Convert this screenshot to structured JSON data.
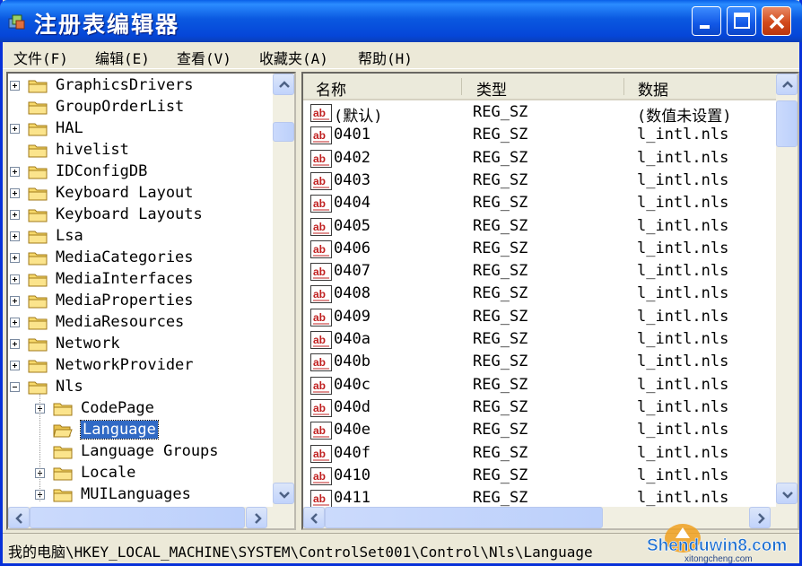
{
  "window": {
    "title": "注册表编辑器"
  },
  "menu": [
    {
      "label": "文件(F)"
    },
    {
      "label": "编辑(E)"
    },
    {
      "label": "查看(V)"
    },
    {
      "label": "收藏夹(A)"
    },
    {
      "label": "帮助(H)"
    }
  ],
  "tree": {
    "items": [
      {
        "label": "GraphicsDrivers",
        "expander": "plus",
        "level": 0
      },
      {
        "label": "GroupOrderList",
        "expander": "none",
        "level": 0
      },
      {
        "label": "HAL",
        "expander": "plus",
        "level": 0
      },
      {
        "label": "hivelist",
        "expander": "none",
        "level": 0
      },
      {
        "label": "IDConfigDB",
        "expander": "plus",
        "level": 0
      },
      {
        "label": "Keyboard Layout",
        "expander": "plus",
        "level": 0
      },
      {
        "label": "Keyboard Layouts",
        "expander": "plus",
        "level": 0
      },
      {
        "label": "Lsa",
        "expander": "plus",
        "level": 0
      },
      {
        "label": "MediaCategories",
        "expander": "plus",
        "level": 0
      },
      {
        "label": "MediaInterfaces",
        "expander": "plus",
        "level": 0
      },
      {
        "label": "MediaProperties",
        "expander": "plus",
        "level": 0
      },
      {
        "label": "MediaResources",
        "expander": "plus",
        "level": 0
      },
      {
        "label": "Network",
        "expander": "plus",
        "level": 0
      },
      {
        "label": "NetworkProvider",
        "expander": "plus",
        "level": 0
      },
      {
        "label": "Nls",
        "expander": "minus",
        "level": 0
      },
      {
        "label": "CodePage",
        "expander": "plus",
        "level": 1
      },
      {
        "label": "Language",
        "expander": "none",
        "level": 1,
        "selected": true
      },
      {
        "label": "Language Groups",
        "expander": "none",
        "level": 1
      },
      {
        "label": "Locale",
        "expander": "plus",
        "level": 1
      },
      {
        "label": "MUILanguages",
        "expander": "plus",
        "level": 1
      }
    ]
  },
  "list": {
    "columns": [
      "名称",
      "类型",
      "数据"
    ],
    "rows": [
      {
        "name": "(默认)",
        "type": "REG_SZ",
        "data": "(数值未设置)"
      },
      {
        "name": "0401",
        "type": "REG_SZ",
        "data": "l_intl.nls"
      },
      {
        "name": "0402",
        "type": "REG_SZ",
        "data": "l_intl.nls"
      },
      {
        "name": "0403",
        "type": "REG_SZ",
        "data": "l_intl.nls"
      },
      {
        "name": "0404",
        "type": "REG_SZ",
        "data": "l_intl.nls"
      },
      {
        "name": "0405",
        "type": "REG_SZ",
        "data": "l_intl.nls"
      },
      {
        "name": "0406",
        "type": "REG_SZ",
        "data": "l_intl.nls"
      },
      {
        "name": "0407",
        "type": "REG_SZ",
        "data": "l_intl.nls"
      },
      {
        "name": "0408",
        "type": "REG_SZ",
        "data": "l_intl.nls"
      },
      {
        "name": "0409",
        "type": "REG_SZ",
        "data": "l_intl.nls"
      },
      {
        "name": "040a",
        "type": "REG_SZ",
        "data": "l_intl.nls"
      },
      {
        "name": "040b",
        "type": "REG_SZ",
        "data": "l_intl.nls"
      },
      {
        "name": "040c",
        "type": "REG_SZ",
        "data": "l_intl.nls"
      },
      {
        "name": "040d",
        "type": "REG_SZ",
        "data": "l_intl.nls"
      },
      {
        "name": "040e",
        "type": "REG_SZ",
        "data": "l_intl.nls"
      },
      {
        "name": "040f",
        "type": "REG_SZ",
        "data": "l_intl.nls"
      },
      {
        "name": "0410",
        "type": "REG_SZ",
        "data": "l_intl.nls"
      },
      {
        "name": "0411",
        "type": "REG_SZ",
        "data": "l_intl.nls"
      }
    ]
  },
  "status": {
    "path": "我的电脑\\HKEY_LOCAL_MACHINE\\SYSTEM\\ControlSet001\\Control\\Nls\\Language"
  },
  "watermark": {
    "text": "Shenduwin8.com",
    "sub": "xitongcheng.com"
  },
  "colors": {
    "title_blue": "#0546d8",
    "selection": "#316ac5",
    "close_red": "#d24a1c",
    "folder_yellow": "#f7d96b"
  }
}
